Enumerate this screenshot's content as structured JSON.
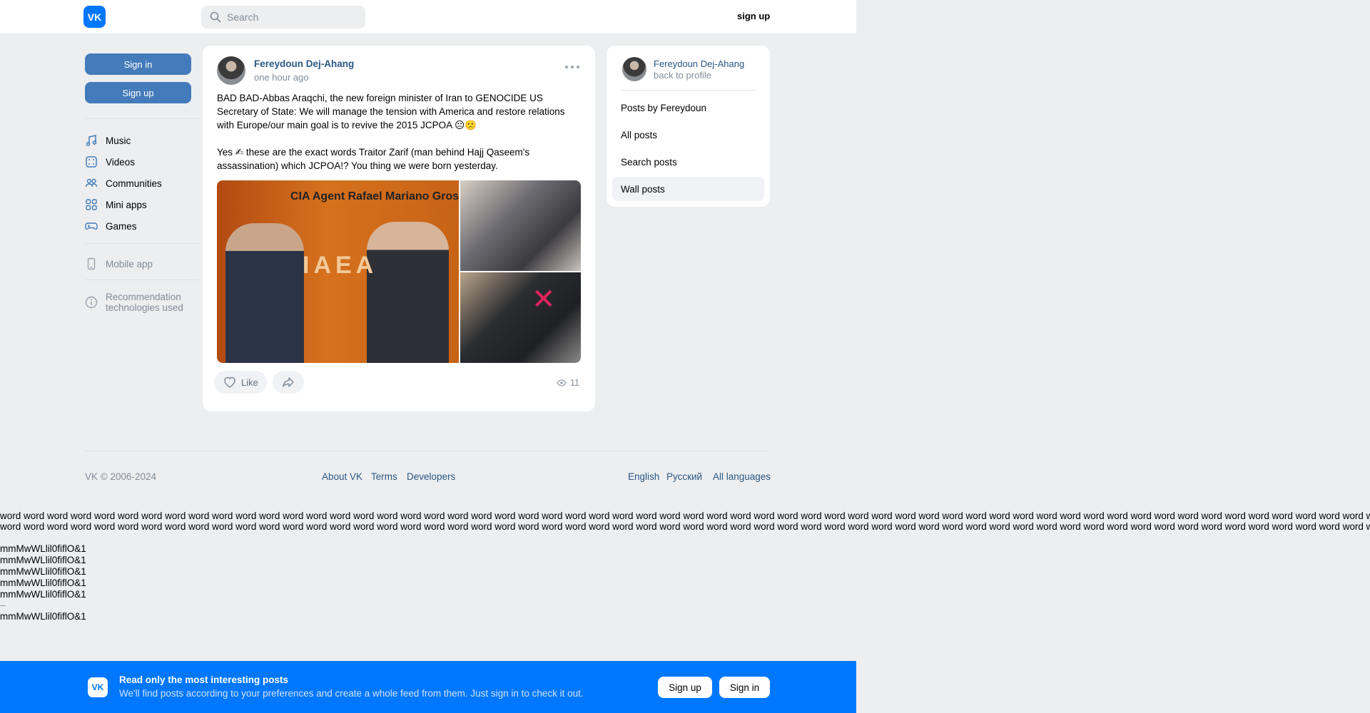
{
  "header": {
    "logo": "VK",
    "search_placeholder": "Search",
    "signup": "sign up"
  },
  "left": {
    "sign_in": "Sign in",
    "sign_up": "Sign up",
    "nav": [
      {
        "label": "Music",
        "icon": "music-icon"
      },
      {
        "label": "Videos",
        "icon": "video-icon"
      },
      {
        "label": "Communities",
        "icon": "communities-icon"
      },
      {
        "label": "Mini apps",
        "icon": "mini-apps-icon"
      },
      {
        "label": "Games",
        "icon": "gamepad-icon"
      }
    ],
    "mobile_app": "Mobile app",
    "recommendation": "Recommendation technologies used"
  },
  "post": {
    "author": "Fereydoun Dej-Ahang",
    "time": "one hour ago",
    "text1": "BAD BAD-Abbas Araqchi, the new foreign minister of Iran to GENOCIDE US Secretary of State: We will manage the tension with America and restore relations with Europe/our main goal is to revive the 2015 JCPOA 😐🙁",
    "text2": "Yes ✍ these are the exact words Traitor Zarif (man behind Hajj Qaseem's assassination) which JCPOA!? You thing we were born yesterday.",
    "photo_caption": "CIA Agent Rafael Mariano Gross",
    "photo_sign": "IAEA",
    "like": "Like",
    "views": "11"
  },
  "right": {
    "name": "Fereydoun Dej-Ahang",
    "back": "back to profile",
    "links": [
      "Posts by Fereydoun",
      "All posts",
      "Search posts",
      "Wall posts"
    ]
  },
  "footer": {
    "copyright": "VK © 2006-2024",
    "about": "About VK",
    "terms": "Terms",
    "developers": "Developers",
    "english": "English",
    "russian": "Русский",
    "all_languages": "All languages"
  },
  "junk": {
    "line": "word word word word word word word word word word word word word word word word word word word word word word word word word word word word word word word word word word word word word word word word word word word word word word word word word word word word word word word word word word word word word word word word word word",
    "glyphs": "mmMwWLlil0fiflO&1"
  },
  "banner": {
    "title": "Read only the most interesting posts",
    "subtitle": "We'll find posts according to your preferences and create a whole feed from them. Just sign in to check it out.",
    "sign_up": "Sign up",
    "sign_in": "Sign in"
  },
  "colors": {
    "accent": "#0077ff",
    "button": "#447bba",
    "link": "#2a5885",
    "background": "#edeef0"
  }
}
